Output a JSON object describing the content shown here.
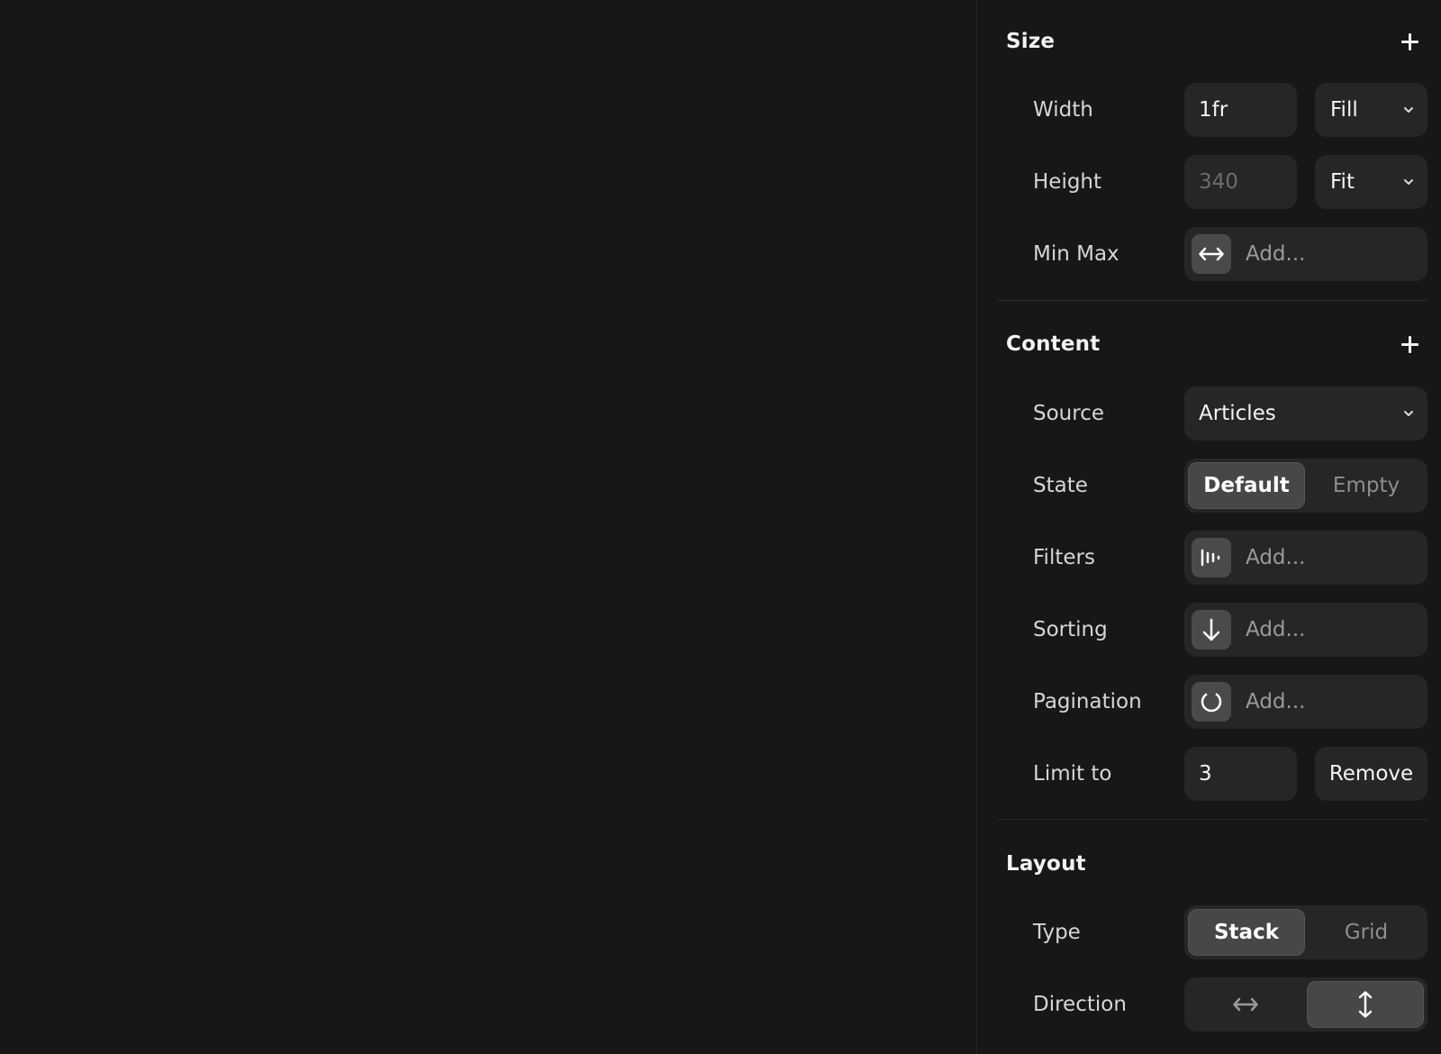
{
  "panel": {
    "size": {
      "title": "Size",
      "width": {
        "label": "Width",
        "value": "1fr",
        "mode": "Fill"
      },
      "height": {
        "label": "Height",
        "placeholder": "340",
        "mode": "Fit"
      },
      "minmax": {
        "label": "Min Max",
        "add_text": "Add...",
        "icon": "horizontal-arrows-icon"
      }
    },
    "content": {
      "title": "Content",
      "source": {
        "label": "Source",
        "value": "Articles"
      },
      "state": {
        "label": "State",
        "options": [
          "Default",
          "Empty"
        ],
        "selected": "Default"
      },
      "filters": {
        "label": "Filters",
        "add_text": "Add...",
        "icon": "filter-bars-icon"
      },
      "sorting": {
        "label": "Sorting",
        "add_text": "Add...",
        "icon": "arrow-down-icon"
      },
      "pagination": {
        "label": "Pagination",
        "add_text": "Add...",
        "icon": "loading-circle-icon"
      },
      "limit": {
        "label": "Limit to",
        "value": "3",
        "remove_label": "Remove"
      }
    },
    "layout": {
      "title": "Layout",
      "type": {
        "label": "Type",
        "options": [
          "Stack",
          "Grid"
        ],
        "selected": "Stack"
      },
      "direction": {
        "label": "Direction",
        "options": [
          "horizontal",
          "vertical"
        ],
        "selected": "vertical"
      }
    }
  },
  "colors": {
    "background": "#171717",
    "field": "#262626",
    "active_segment": "#474747",
    "icon_box": "#4a4a4a"
  }
}
